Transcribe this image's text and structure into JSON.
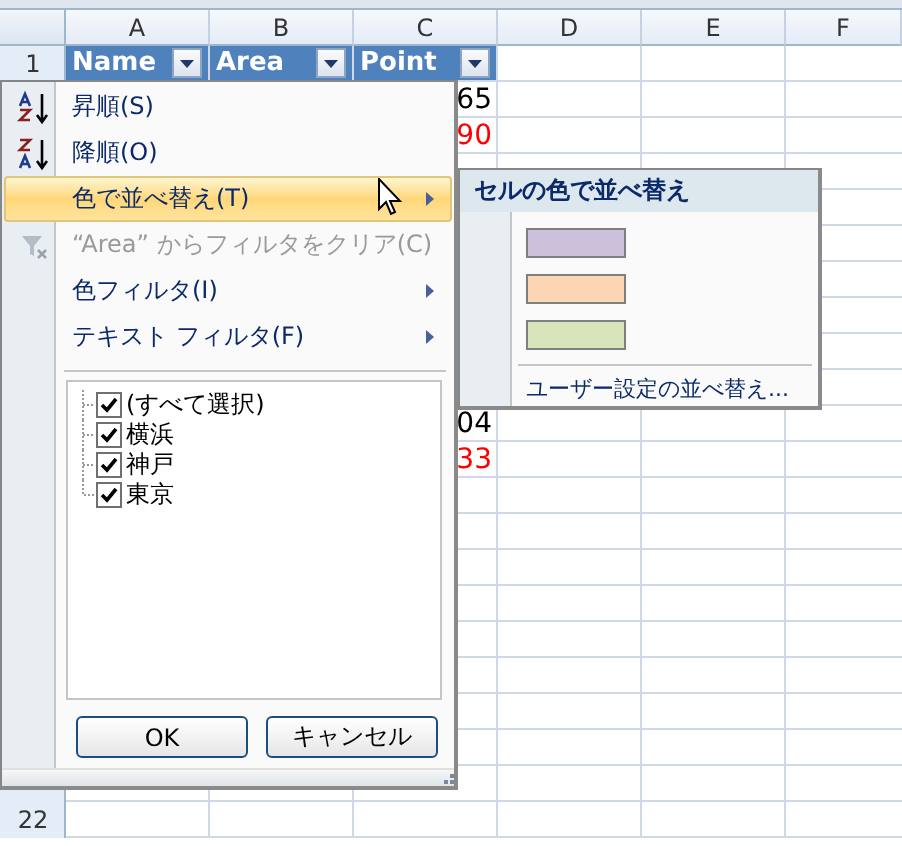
{
  "columns": [
    "A",
    "B",
    "C",
    "D",
    "E",
    "F"
  ],
  "rows": [
    {
      "header": "1",
      "cells": [
        {
          "text": "Name"
        },
        {
          "text": "Area"
        },
        {
          "text": "Point"
        }
      ]
    },
    {
      "c_value": "65",
      "color": "#000000"
    },
    {
      "c_value": "90",
      "color": "#ff0000"
    },
    {},
    {},
    {},
    {},
    {},
    {},
    {},
    {
      "c_value": "04",
      "color": "#000000"
    },
    {
      "c_value": "33",
      "color": "#ff0000"
    },
    {},
    {},
    {},
    {},
    {},
    {},
    {},
    {},
    {},
    {
      "header": "22"
    }
  ],
  "menu": {
    "items": [
      {
        "label": "昇順(S)",
        "kind": "sort-asc",
        "selected": false,
        "disabled": false,
        "submenu": false
      },
      {
        "label": "降順(O)",
        "kind": "sort-desc",
        "selected": false,
        "disabled": false,
        "submenu": false
      },
      {
        "label": "色で並べ替え(T)",
        "kind": "plain",
        "selected": true,
        "disabled": false,
        "submenu": true
      },
      {
        "label": "“Area” からフィルタをクリア(C)",
        "kind": "clear-filter",
        "selected": false,
        "disabled": true,
        "submenu": false
      },
      {
        "label": "色フィルタ(I)",
        "kind": "plain",
        "selected": false,
        "disabled": false,
        "submenu": true
      },
      {
        "label": "テキスト フィルタ(F)",
        "kind": "plain",
        "selected": false,
        "disabled": false,
        "submenu": true
      }
    ],
    "checklist": [
      {
        "label": "(すべて選択)",
        "checked": true
      },
      {
        "label": "横浜",
        "checked": true
      },
      {
        "label": "神戸",
        "checked": true
      },
      {
        "label": "東京",
        "checked": true
      }
    ],
    "buttons": [
      "OK",
      "キャンセル"
    ]
  },
  "submenu": {
    "title": "セルの色で並べ替え",
    "swatches": [
      {
        "color": "#ccc0da"
      },
      {
        "color": "#fcd5b4"
      },
      {
        "color": "#d8e4bc"
      }
    ],
    "custom": "ユーザー設定の並べ替え..."
  }
}
